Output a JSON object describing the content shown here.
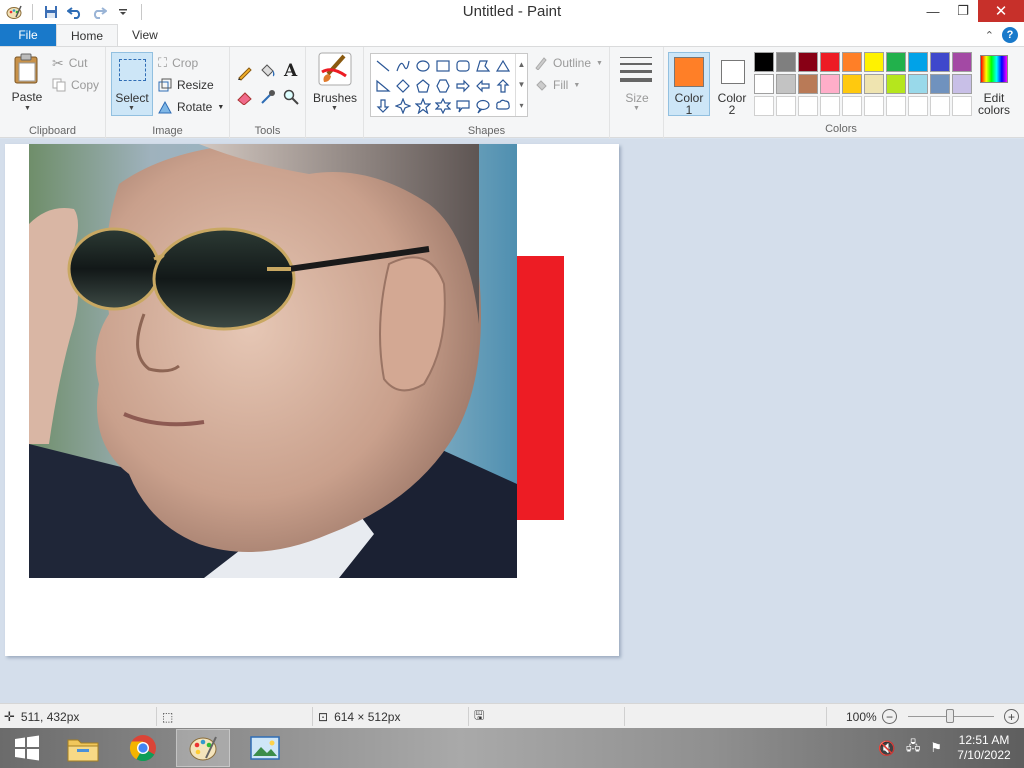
{
  "window": {
    "title": "Untitled - Paint",
    "controls": {
      "minimize": "—",
      "restore": "❐",
      "close": "✕"
    }
  },
  "tabs": {
    "file": "File",
    "home": "Home",
    "view": "View"
  },
  "ribbon": {
    "clipboard": {
      "paste": "Paste",
      "cut": "Cut",
      "copy": "Copy",
      "label": "Clipboard"
    },
    "image": {
      "select": "Select",
      "crop": "Crop",
      "resize": "Resize",
      "rotate": "Rotate",
      "label": "Image"
    },
    "tools": {
      "label": "Tools"
    },
    "brushes": {
      "label": "Brushes"
    },
    "shapes": {
      "outline": "Outline",
      "fill": "Fill",
      "label": "Shapes"
    },
    "size": {
      "label": "Size"
    },
    "color1": {
      "label1": "Color",
      "label2": "1",
      "value": "#ff7f27"
    },
    "color2": {
      "label1": "Color",
      "label2": "2",
      "value": "#ffffff"
    },
    "edit_colors": {
      "label1": "Edit",
      "label2": "colors"
    },
    "colors_label": "Colors",
    "palette": [
      [
        "#000000",
        "#7f7f7f",
        "#880015",
        "#ed1c24",
        "#ff7f27",
        "#fff200",
        "#22b14c",
        "#00a2e8",
        "#3f48cc",
        "#a349a4"
      ],
      [
        "#ffffff",
        "#c3c3c3",
        "#b97a57",
        "#ffaec9",
        "#ffc90e",
        "#efe4b0",
        "#b5e61d",
        "#99d9ea",
        "#7092be",
        "#c8bfe7"
      ],
      [
        "",
        "",
        "",
        "",
        "",
        "",
        "",
        "",
        "",
        ""
      ]
    ]
  },
  "canvas": {
    "rect_color": "#ed1c24"
  },
  "status": {
    "cursor_pos": "511, 432px",
    "canvas_size": "614 × 512px",
    "zoom": "100%"
  },
  "taskbar": {
    "time": "12:51 AM",
    "date": "7/10/2022"
  }
}
